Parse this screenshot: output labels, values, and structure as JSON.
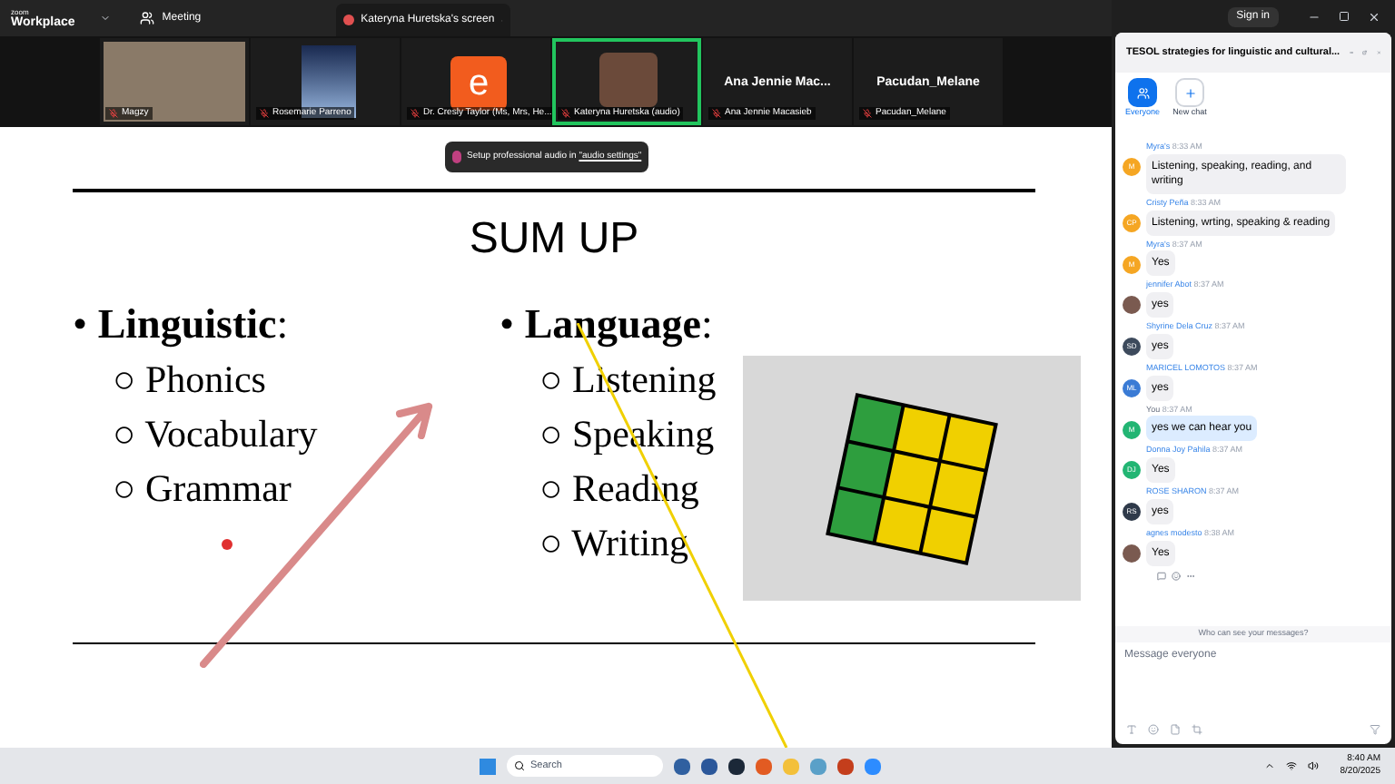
{
  "top_bar": {
    "logo_top": "zoom",
    "logo_bottom": "Workplace",
    "meeting_tab": "Meeting",
    "share_tab": "Kateryna Huretska's screen",
    "sign_in": "Sign in"
  },
  "gallery": [
    {
      "label": "Magzy",
      "kind": "video",
      "active_speaker": false
    },
    {
      "label": "Rosemarie Parreno",
      "kind": "picture",
      "active_speaker": false
    },
    {
      "label": "Dr. Cresly Taylor (Ms, Mrs, He...",
      "kind": "letter",
      "letter": "e",
      "active_speaker": false
    },
    {
      "label": "Kateryna Huretska (audio)",
      "kind": "picture_small",
      "active_speaker": true
    },
    {
      "label": "Ana Jennie Macasieb",
      "kind": "name",
      "name": "Ana Jennie Mac...",
      "active_speaker": false
    },
    {
      "label": "Pacudan_Melane",
      "kind": "name",
      "name": "Pacudan_Melane",
      "active_speaker": false
    }
  ],
  "toast": {
    "text": "Setup professional audio in ",
    "link": "\"audio settings\""
  },
  "slide": {
    "title": "SUM UP",
    "columns": [
      {
        "bullet": "•",
        "heading": "Linguistic",
        "suffix": ":",
        "sub_bullet": "○",
        "items": [
          "Phonics",
          "Vocabulary",
          "Grammar"
        ]
      },
      {
        "bullet": "•",
        "heading": "Language",
        "suffix": ":",
        "sub_bullet": "○",
        "items": [
          "Listening",
          "Speaking",
          "Reading",
          "Writing"
        ]
      }
    ]
  },
  "chat": {
    "title": "TESOL strategies for linguistic and cultural...",
    "targets": [
      {
        "label": "Everyone",
        "selected": true
      },
      {
        "label": "New chat",
        "selected": false
      }
    ],
    "messages": [
      {
        "sender": "Myra's",
        "time": "8:33 AM",
        "text": "Listening, speaking, reading, and writing",
        "kind": "initials",
        "initials": "M",
        "color": "#f5a623",
        "own": false
      },
      {
        "sender": "Cristy Peña",
        "time": "8:33 AM",
        "text": "Listening, wrting, speaking & reading",
        "kind": "initials",
        "initials": "CP",
        "color": "#f5a623",
        "own": false
      },
      {
        "sender": "Myra's",
        "time": "8:37 AM",
        "text": "Yes",
        "kind": "initials",
        "initials": "M",
        "color": "#f5a623",
        "own": false
      },
      {
        "sender": "jennifer Abot",
        "time": "8:37 AM",
        "text": "yes",
        "kind": "photo",
        "own": false
      },
      {
        "sender": "Shyrine Dela Cruz",
        "time": "8:37 AM",
        "text": "yes",
        "kind": "initials",
        "initials": "SD",
        "color": "#3d4a5c",
        "own": false
      },
      {
        "sender": "MARICEL LOMOTOS",
        "time": "8:37 AM",
        "text": "yes",
        "kind": "initials",
        "initials": "ML",
        "color": "#3a7bd5",
        "own": false
      },
      {
        "sender": "You",
        "time": "8:37 AM",
        "text": "yes we can hear you",
        "kind": "initials",
        "initials": "M",
        "color": "#22b573",
        "own": true
      },
      {
        "sender": "Donna Joy Pahila",
        "time": "8:37 AM",
        "text": "Yes",
        "kind": "initials",
        "initials": "DJ",
        "color": "#22b573",
        "own": false
      },
      {
        "sender": "ROSE SHARON",
        "time": "8:37 AM",
        "text": "yes",
        "kind": "initials",
        "initials": "RS",
        "color": "#2f3a4a",
        "own": false
      },
      {
        "sender": "agnes modesto",
        "time": "8:38 AM",
        "text": "Yes",
        "kind": "photo",
        "own": false
      }
    ],
    "privacy": "Who can see your messages?",
    "input_placeholder": "Message everyone"
  },
  "taskbar": {
    "search_placeholder": "Search",
    "time": "8:40 AM",
    "date": "8/20/2025"
  }
}
